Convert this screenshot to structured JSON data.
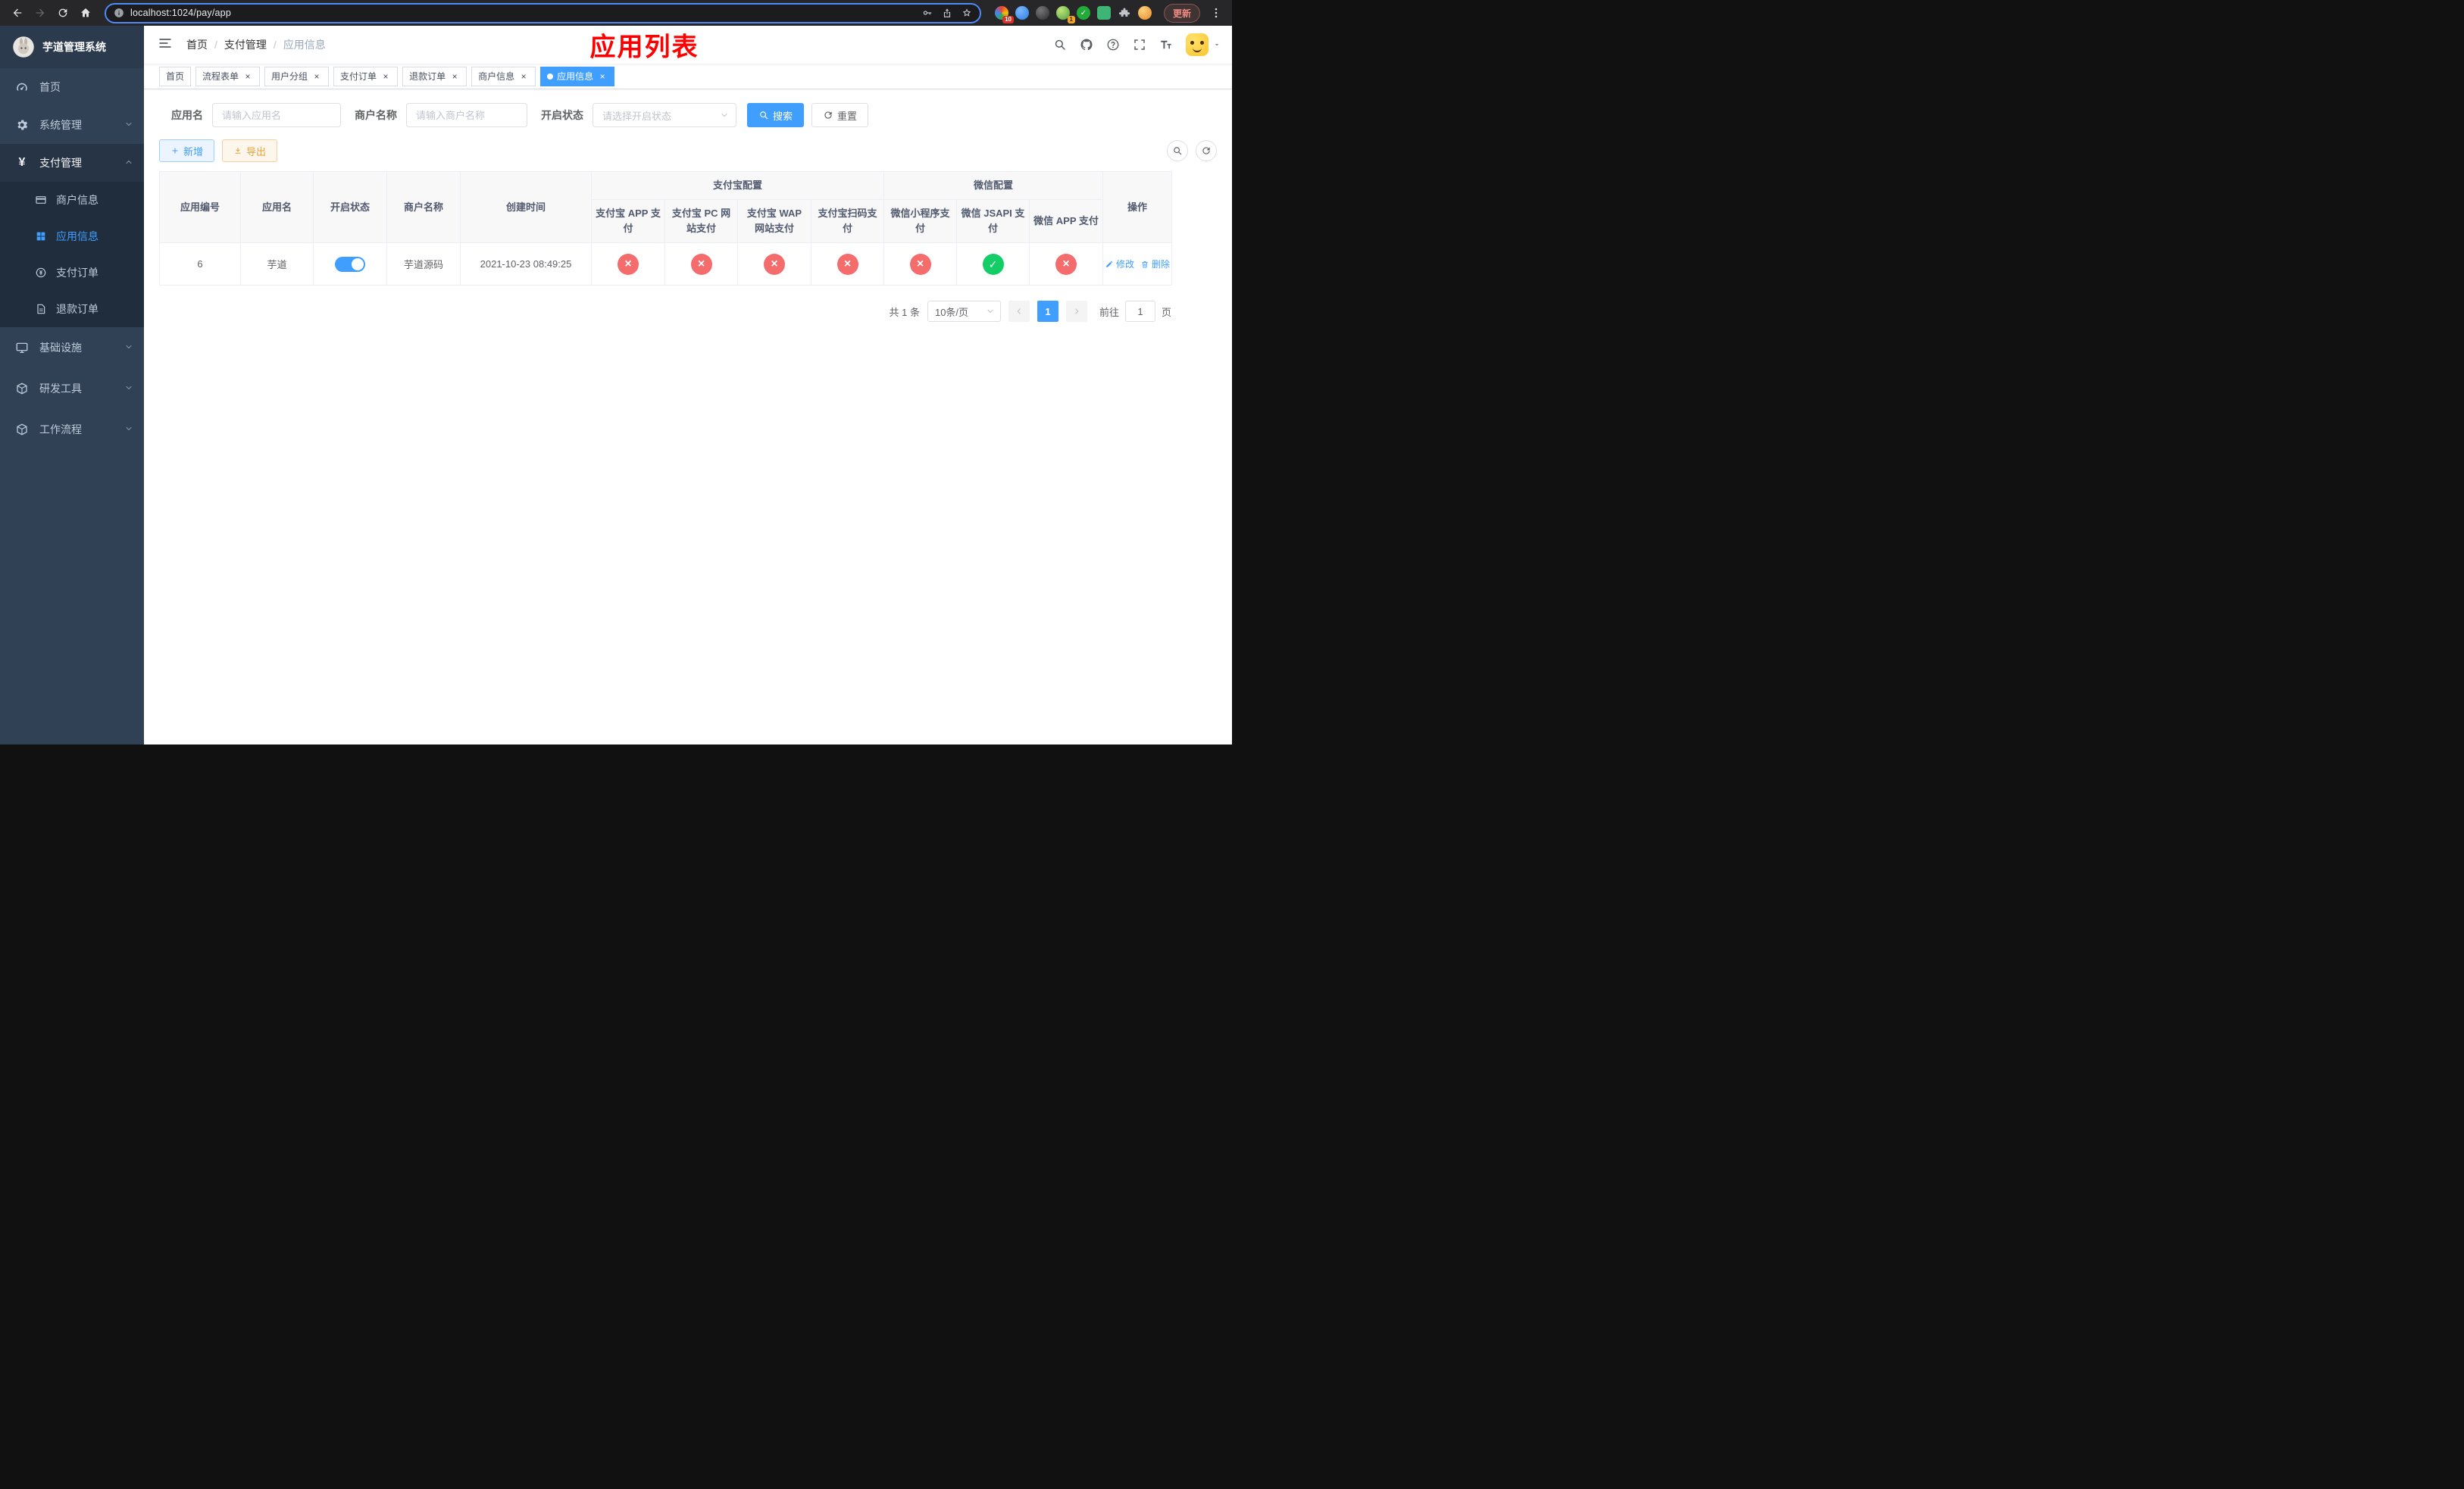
{
  "browser": {
    "url": "localhost:1024/pay/app",
    "update_button": "更新",
    "extension_badge_1": "10",
    "extension_badge_2": "1"
  },
  "sidebar": {
    "title": "芋道管理系统",
    "menu": [
      {
        "label": "首页"
      },
      {
        "label": "系统管理"
      },
      {
        "label": "支付管理"
      },
      {
        "label": "基础设施"
      },
      {
        "label": "研发工具"
      },
      {
        "label": "工作流程"
      }
    ],
    "submenu": [
      {
        "label": "商户信息"
      },
      {
        "label": "应用信息"
      },
      {
        "label": "支付订单"
      },
      {
        "label": "退款订单"
      }
    ]
  },
  "header": {
    "breadcrumb": [
      "首页",
      "支付管理",
      "应用信息"
    ],
    "annotation": "应用列表"
  },
  "tabs": [
    {
      "label": "首页"
    },
    {
      "label": "流程表单"
    },
    {
      "label": "用户分组"
    },
    {
      "label": "支付订单"
    },
    {
      "label": "退款订单"
    },
    {
      "label": "商户信息"
    },
    {
      "label": "应用信息"
    }
  ],
  "filters": {
    "app_name_label": "应用名",
    "app_name_placeholder": "请输入应用名",
    "merchant_label": "商户名称",
    "merchant_placeholder": "请输入商户名称",
    "status_label": "开启状态",
    "status_placeholder": "请选择开启状态",
    "search_button": "搜索",
    "reset_button": "重置"
  },
  "toolbar": {
    "add_button": "新增",
    "export_button": "导出"
  },
  "table": {
    "main_headers": [
      "应用编号",
      "应用名",
      "开启状态",
      "商户名称",
      "创建时间"
    ],
    "group_headers": [
      {
        "label": "支付宝配置"
      },
      {
        "label": "微信配置"
      }
    ],
    "sub_headers": [
      "支付宝 APP 支付",
      "支付宝 PC 网站支付",
      "支付宝 WAP 网站支付",
      "支付宝扫码支付",
      "微信小程序支付",
      "微信 JSAPI 支付",
      "微信 APP 支付"
    ],
    "action_header": "操作",
    "rows": [
      {
        "id": "6",
        "name": "芋道",
        "enabled": true,
        "merchant": "芋道源码",
        "created": "2021-10-23 08:49:25",
        "configs": [
          "disabled",
          "disabled",
          "disabled",
          "disabled",
          "disabled",
          "enabled",
          "disabled"
        ],
        "edit_label": "修改",
        "delete_label": "删除"
      }
    ]
  },
  "pagination": {
    "total": "共 1 条",
    "page_size": "10条/页",
    "current_page": "1",
    "goto_label": "前往",
    "goto_value": "1",
    "page_unit": "页"
  },
  "colors": {
    "primary": "#409eff",
    "danger": "#f56c6c",
    "success": "#13ce66",
    "warning": "#e6a23c",
    "annotation_red": "#ff0000"
  }
}
